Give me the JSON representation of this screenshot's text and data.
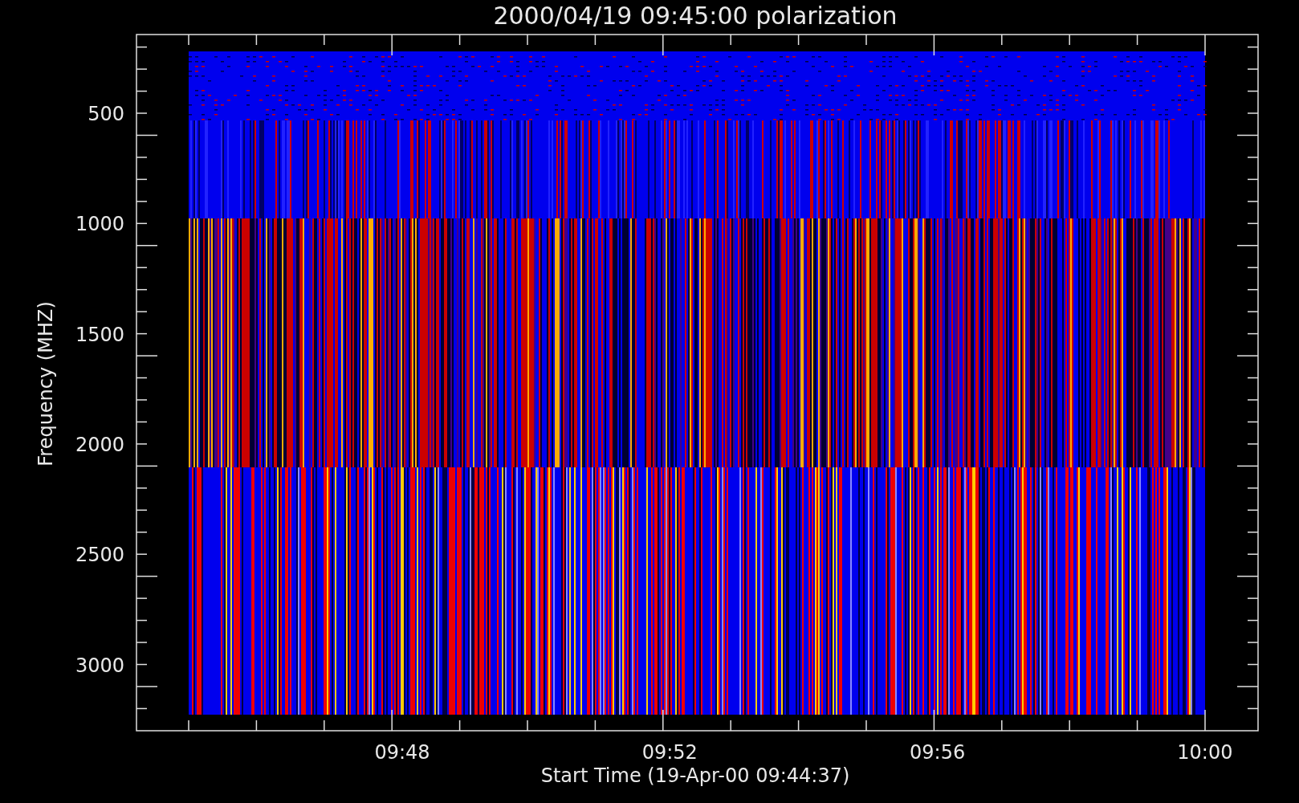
{
  "title": "2000/04/19 09:45:00 polarization",
  "y_axis": {
    "label": "Frequency (MHZ)",
    "ticks": [
      "500",
      "1000",
      "1500",
      "2000",
      "2500",
      "3000"
    ]
  },
  "x_axis": {
    "label": "Start Time (19-Apr-00 09:44:37)",
    "ticks": [
      "09:48",
      "09:52",
      "09:56",
      "10:00"
    ]
  }
}
